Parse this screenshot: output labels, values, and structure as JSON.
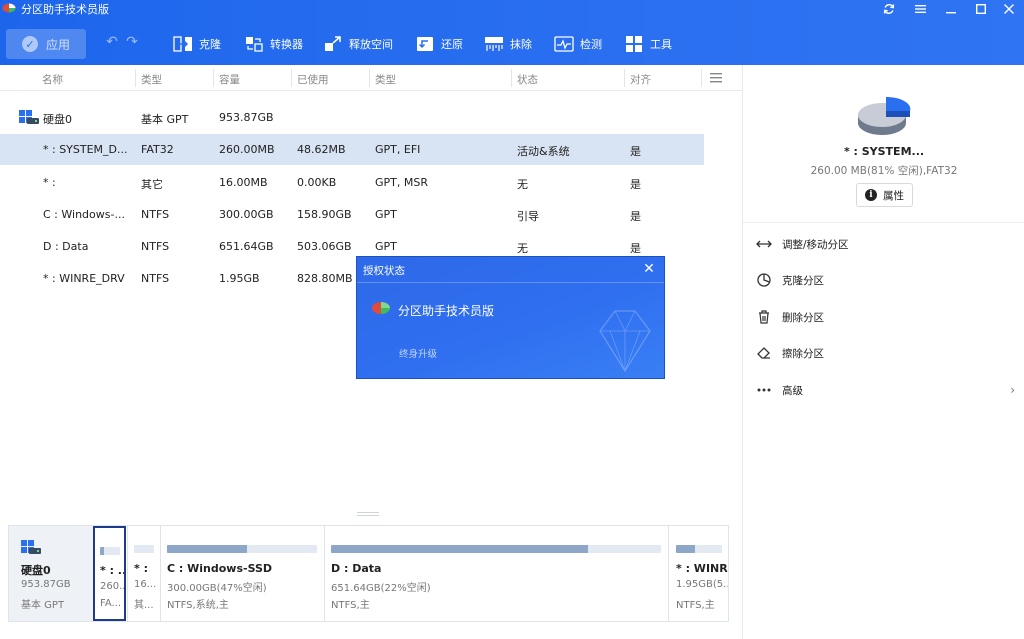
{
  "window": {
    "title": "分区助手技术员版",
    "controls": [
      "refresh-icon",
      "menu-icon",
      "minimize-icon",
      "maximize-icon",
      "close-icon"
    ]
  },
  "toolbar": {
    "apply": "应用",
    "tools": [
      {
        "label": "克隆",
        "icon": "clone-icon"
      },
      {
        "label": "转换器",
        "icon": "converter-icon"
      },
      {
        "label": "释放空间",
        "icon": "free-space-icon"
      },
      {
        "label": "还原",
        "icon": "restore-icon"
      },
      {
        "label": "抹除",
        "icon": "wipe-icon"
      },
      {
        "label": "检测",
        "icon": "check-icon"
      },
      {
        "label": "工具",
        "icon": "tools-icon"
      }
    ]
  },
  "table": {
    "headers": [
      "名称",
      "类型",
      "容量",
      "已使用",
      "类型",
      "状态",
      "对齐"
    ],
    "disk": {
      "name": "硬盘0",
      "type": "基本 GPT",
      "capacity": "953.87GB"
    },
    "rows": [
      {
        "name": "* : SYSTEM_D...",
        "fs": "FAT32",
        "capacity": "260.00MB",
        "used": "48.62MB",
        "type": "GPT, EFI",
        "status": "活动&系统",
        "align": "是"
      },
      {
        "name": "* :",
        "fs": "其它",
        "capacity": "16.00MB",
        "used": "0.00KB",
        "type": "GPT, MSR",
        "status": "无",
        "align": "是"
      },
      {
        "name": "C : Windows-...",
        "fs": "NTFS",
        "capacity": "300.00GB",
        "used": "158.90GB",
        "type": "GPT",
        "status": "引导",
        "align": "是"
      },
      {
        "name": "D : Data",
        "fs": "NTFS",
        "capacity": "651.64GB",
        "used": "503.06GB",
        "type": "GPT",
        "status": "无",
        "align": "是"
      },
      {
        "name": "* : WINRE_DRV",
        "fs": "NTFS",
        "capacity": "1.95GB",
        "used": "828.80MB",
        "type": "",
        "status": "",
        "align": ""
      }
    ]
  },
  "modal": {
    "title": "授权状态",
    "product": "分区助手技术员版",
    "subtitle": "终身升级"
  },
  "disk_map": {
    "disk": {
      "name": "硬盘0",
      "size": "953.87GB",
      "type": "基本 GPT"
    },
    "parts": [
      {
        "name": "* : ...",
        "l2": "260...",
        "l3": "FA...",
        "fill": 0.19
      },
      {
        "name": "* :",
        "l2": "16...",
        "l3": "其...",
        "fill": 0.0
      },
      {
        "name": "C : Windows-SSD",
        "l2": "300.00GB(47%空闲)",
        "l3": "NTFS,系统,主",
        "fill": 0.53
      },
      {
        "name": "D : Data",
        "l2": "651.64GB(22%空闲)",
        "l3": "NTFS,主",
        "fill": 0.78
      },
      {
        "name": "* : WINR...",
        "l2": "1.95GB(5...",
        "l3": "NTFS,主",
        "fill": 0.42
      }
    ]
  },
  "right_panel": {
    "name": "* : SYSTEM...",
    "info": "260.00 MB(81% 空闲),FAT32",
    "properties": "属性",
    "used_fraction": 0.19,
    "operations": [
      {
        "label": "调整/移动分区",
        "icon": "resize-move-icon"
      },
      {
        "label": "克隆分区",
        "icon": "clone-partition-icon"
      },
      {
        "label": "删除分区",
        "icon": "trash-icon"
      },
      {
        "label": "擦除分区",
        "icon": "eraser-icon"
      },
      {
        "label": "高级",
        "icon": "more-icon"
      }
    ]
  },
  "colors": {
    "accent": "#2a6ff0",
    "selected_row": "#d8e3f3",
    "bar_fill": "#8ea6c8"
  }
}
